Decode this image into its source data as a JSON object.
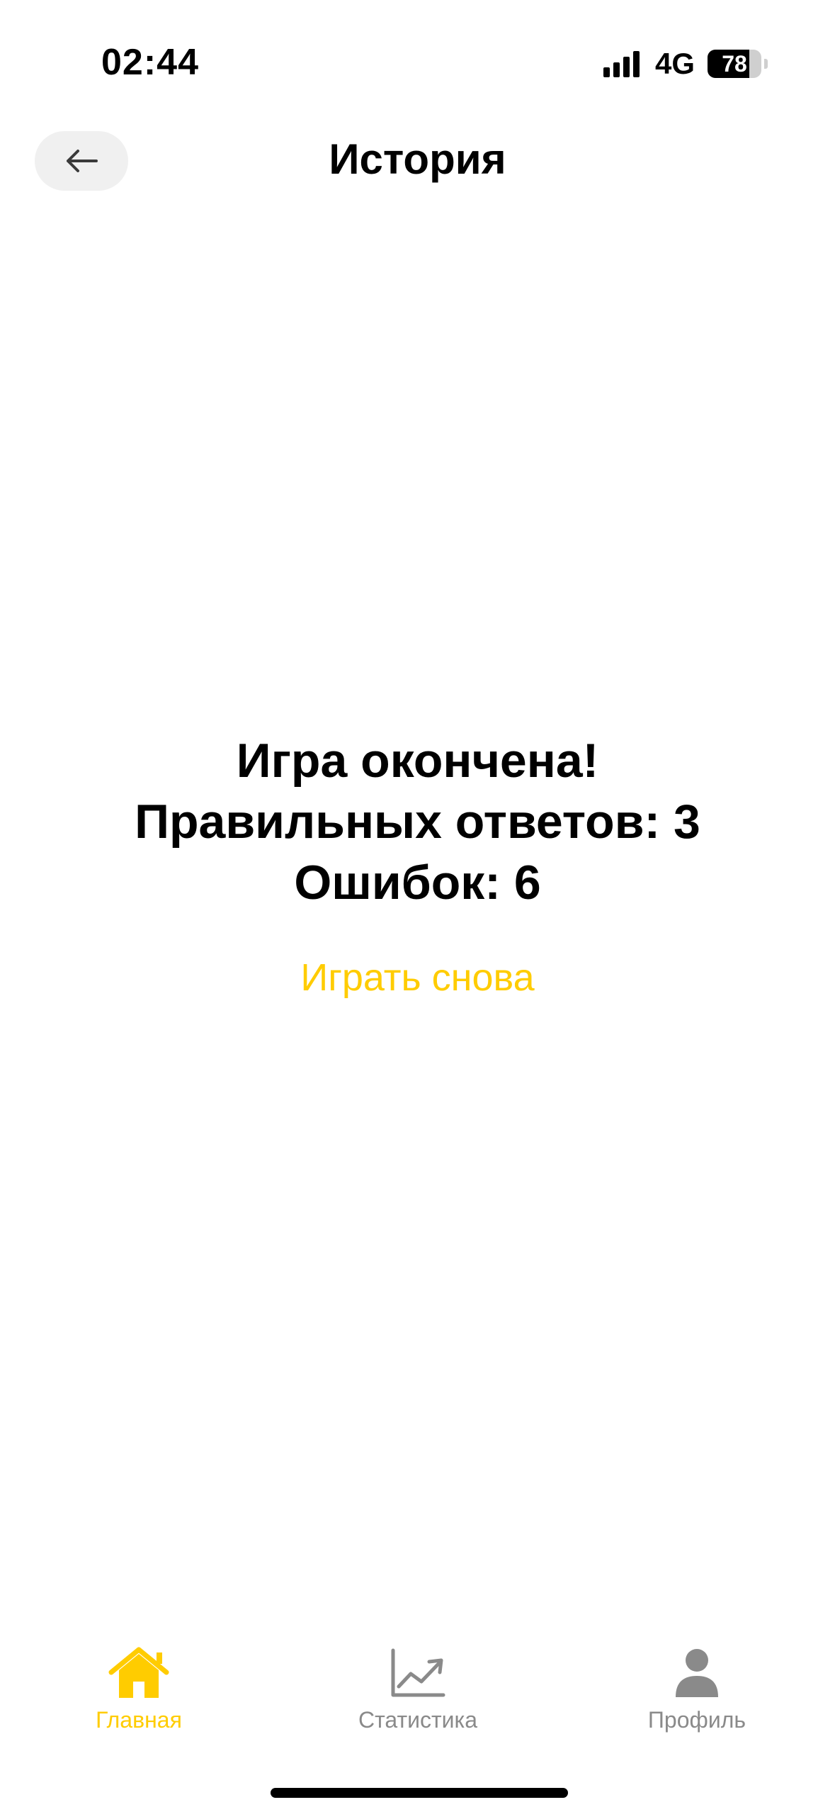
{
  "status_bar": {
    "time": "02:44",
    "network": "4G",
    "battery": "78",
    "battery_level": 0.78,
    "signal_icon": "cellular-signal-icon"
  },
  "header": {
    "title": "История",
    "back_icon": "arrow-left-icon"
  },
  "result": {
    "line1": "Игра окончена!",
    "line2": "Правильных ответов: 3",
    "line3": "Ошибок: 6",
    "play_again": "Играть снова"
  },
  "tab_bar": {
    "items": [
      {
        "label": "Главная",
        "icon": "home-icon",
        "active": true
      },
      {
        "label": "Статистика",
        "icon": "chart-icon",
        "active": false
      },
      {
        "label": "Профиль",
        "icon": "person-icon",
        "active": false
      }
    ]
  },
  "colors": {
    "accent": "#FFCC00",
    "inactive": "#8A8A8A",
    "button_bg": "#F0F0F0"
  }
}
